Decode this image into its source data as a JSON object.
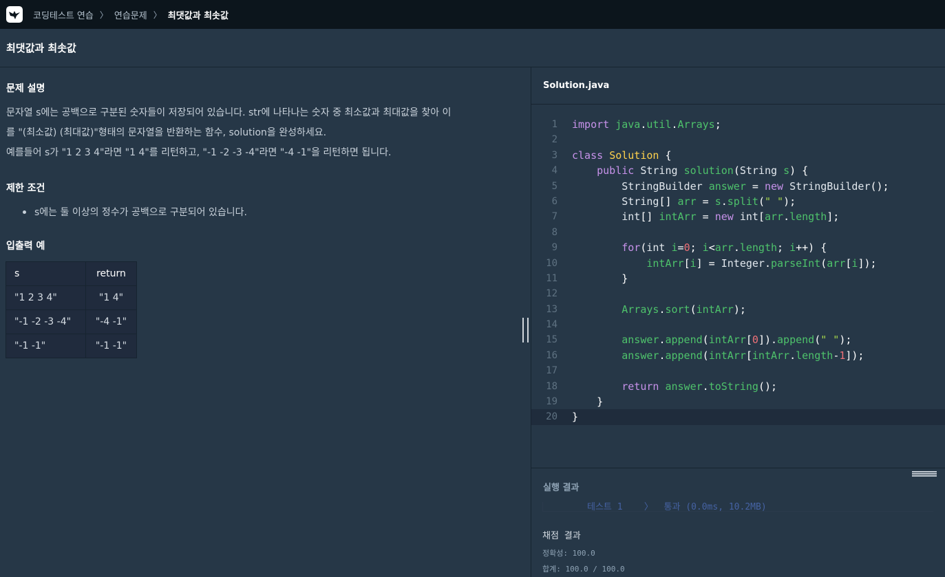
{
  "nav": {
    "breadcrumb": [
      "코딩테스트 연습",
      "연습문제",
      "최댓값과 최솟값"
    ]
  },
  "problem_title": "최댓값과 최솟값",
  "description": {
    "heading": "문제 설명",
    "line1": "문자열 s에는 공백으로 구분된 숫자들이 저장되어 있습니다. str에 나타나는 숫자 중 최소값과 최대값을 찾아 이",
    "line2": "를 \"(최소값) (최대값)\"형태의 문자열을 반환하는 함수, solution을 완성하세요.",
    "line3": "예를들어 s가 \"1 2 3 4\"라면 \"1 4\"를 리턴하고, \"-1 -2 -3 -4\"라면 \"-4 -1\"을 리턴하면 됩니다."
  },
  "constraints": {
    "heading": "제한 조건",
    "items": [
      "s에는 둘 이상의 정수가 공백으로 구분되어 있습니다."
    ]
  },
  "examples": {
    "heading": "입출력 예",
    "headers": [
      "s",
      "return"
    ],
    "rows": [
      [
        "\"1 2 3 4\"",
        "\"1 4\""
      ],
      [
        "\"-1 -2 -3 -4\"",
        "\"-4 -1\""
      ],
      [
        "\"-1 -1\"",
        "\"-1 -1\""
      ]
    ]
  },
  "editor": {
    "filename": "Solution.java",
    "line_numbers": [
      "1",
      "2",
      "3",
      "4",
      "5",
      "6",
      "7",
      "8",
      "9",
      "10",
      "11",
      "12",
      "13",
      "14",
      "15",
      "16",
      "17",
      "18",
      "19",
      "20"
    ],
    "active_line": 20
  },
  "result": {
    "heading": "실행 결과",
    "cutoff_text": "테스트 1    〉  통과 (0.0ms, 10.2MB)",
    "grading_title": "채점 결과",
    "accuracy": "정확성: 100.0",
    "total": "합계: 100.0 / 100.0"
  },
  "colors": {
    "background": "#263747",
    "topnav": "#0c151c",
    "keyword": "#c792ea",
    "identifier": "#4ec26b",
    "class_name": "#ffd24d",
    "number": "#f07178",
    "string": "#a5d64b"
  }
}
